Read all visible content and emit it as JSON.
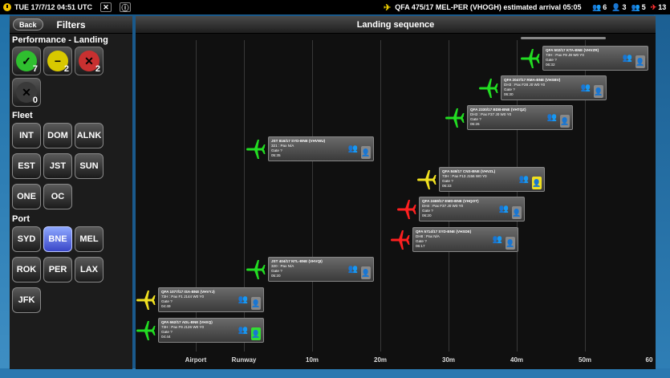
{
  "topbar": {
    "datetime": "TUE 17/7/12 04:51 UTC",
    "flight_info": "QFA 475/17 MEL-PER (VHOGH) estimated arrival 05:05",
    "status": [
      {
        "icon": "people-red-icon",
        "glyph": "👥",
        "color": "#ff3030",
        "value": "6"
      },
      {
        "icon": "person-yellow-icon",
        "glyph": "👤",
        "color": "#ffd500",
        "value": "3"
      },
      {
        "icon": "people-red-icon",
        "glyph": "👥",
        "color": "#ff3030",
        "value": "5"
      },
      {
        "icon": "plane-red-icon",
        "glyph": "✈",
        "color": "#ff3030",
        "value": "13"
      }
    ]
  },
  "left_panel": {
    "back_label": "Back",
    "title": "Filters",
    "performance_label": "Performance - Landing",
    "performance": [
      {
        "icon": "check-icon",
        "glyph": "✓",
        "color": "#2fbf2f",
        "count": "7"
      },
      {
        "icon": "minus-icon",
        "glyph": "−",
        "color": "#d8c800",
        "count": "2"
      },
      {
        "icon": "x-icon",
        "glyph": "✕",
        "color": "#c83030",
        "count": "2"
      },
      {
        "icon": "x-icon",
        "glyph": "✕",
        "color": "#3a3a3a",
        "count": "0"
      }
    ],
    "fleet_label": "Fleet",
    "fleet": [
      "INT",
      "DOM",
      "ALNK",
      "EST",
      "JST",
      "SUN",
      "ONE",
      "OC"
    ],
    "port_label": "Port",
    "port": [
      "SYD",
      "BNE",
      "MEL",
      "ROK",
      "PER",
      "LAX",
      "JFK"
    ],
    "port_selected": "BNE"
  },
  "main": {
    "title": "Landing sequence",
    "axis_labels": [
      "Airport",
      "Runway",
      "10m",
      "20m",
      "30m",
      "40m",
      "50m",
      "60"
    ]
  },
  "colors": {
    "green": "#22dd22",
    "yellow": "#f0e020",
    "red": "#ff2020"
  },
  "flights": [
    {
      "l1": "QFA 502/17 KTA-BNE (VHVZR)",
      "l2": "73H : Pax F9 J8 W0 Y0",
      "gate": "Gate ?",
      "time": "06:32",
      "plane_color": "green",
      "pax_color": "#33dd33",
      "pax_icon": "people-green-icon"
    },
    {
      "l1": "QFA 2047/17 RMA-BNE (VHSBV)",
      "l2": "DH3 : Pax F28 J0 W0 Y0",
      "gate": "Gate ?",
      "time": "06:30",
      "plane_color": "green",
      "pax_color": "#f0e020",
      "pax_icon": "people-yellow-icon"
    },
    {
      "l1": "QFA 2330/17 BDB-BNE (VHTQZ)",
      "l2": "DH3 : Pax F37 J0 W0 Y0",
      "gate": "Gate ?",
      "time": "06:26",
      "plane_color": "green",
      "pax_color": "#ff3030",
      "pax_icon": "people-red-icon"
    },
    {
      "l1": "JST 816/17 SYD-BNE (VHVWU)",
      "l2": "321 : Pax N/A",
      "gate": "Gate ?",
      "time": "05:35",
      "plane_color": "green",
      "pax_color": "#999999",
      "pax_icon": "people-grey-icon"
    },
    {
      "l1": "QFA 849/17 CNS-BNE (VHVZL)",
      "l2": "73H : Pax F13 J156 W0 Y0",
      "gate": "Gate ?",
      "time": "06:33",
      "plane_color": "yellow",
      "pax_color": "#ff3030",
      "pax_icon": "people-red-icon",
      "agent_color": "#f0e020"
    },
    {
      "l1": "QFA 2469/17 EMD-BNE (VHQOT)",
      "l2": "DH4 : Pax F37 J0 W0 Y0",
      "gate": "Gate ?",
      "time": "06:20",
      "plane_color": "red",
      "pax_color": "#f0e020",
      "pax_icon": "people-yellow-icon"
    },
    {
      "l1": "QFA 5714/17 SYD-BNE (VHSDE)",
      "l2": "DH8 : Pax N/A",
      "gate": "Gate ?",
      "time": "06:17",
      "plane_color": "red",
      "pax_color": "#999999",
      "pax_icon": "people-grey-icon"
    },
    {
      "l1": "JST 404/17 NTL-BNE (VHVQI)",
      "l2": "320 : Pax N/A",
      "gate": "Gate ?",
      "time": "05:20",
      "plane_color": "green",
      "pax_color": "#999999",
      "pax_icon": "people-grey-icon"
    },
    {
      "l1": "QFA 1077/17 ISA-BNE (VHVYJ)",
      "l2": "73H : Pax F1 J144 W0 Y0",
      "gate": "Gate ?",
      "time": "04:49",
      "plane_color": "yellow",
      "pax_color": "#ff3030",
      "pax_icon": "people-red-icon"
    },
    {
      "l1": "QFA 662/17 ADL-BNE (VHXQ)",
      "l2": "73H : Pax F9 J126 W0 Y0",
      "gate": "Gate ?",
      "time": "04:44",
      "plane_color": "green",
      "pax_color": "#ff3030",
      "pax_icon": "people-red-icon",
      "agent_color": "#33dd33"
    }
  ]
}
